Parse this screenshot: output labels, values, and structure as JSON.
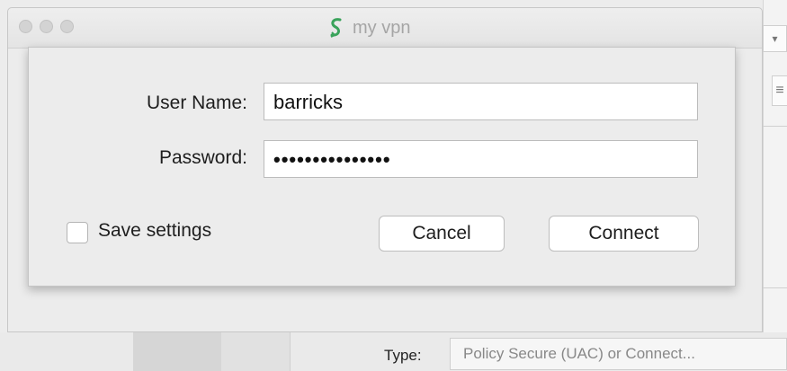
{
  "window": {
    "title": "my vpn",
    "title_icon": "vpn-s-logo-icon"
  },
  "login": {
    "username_label": "User Name:",
    "username_value": "barricks",
    "password_label": "Password:",
    "password_value": "•••••••••••••••",
    "save_settings_label": "Save settings",
    "save_settings_checked": false,
    "cancel_label": "Cancel",
    "connect_label": "Connect"
  },
  "background": {
    "type_label": "Type:",
    "type_value": "Policy Secure (UAC) or Connect...",
    "popup_arrow": "▾",
    "list_icon": "≡"
  },
  "colors": {
    "logo_green": "#3aa35b"
  }
}
